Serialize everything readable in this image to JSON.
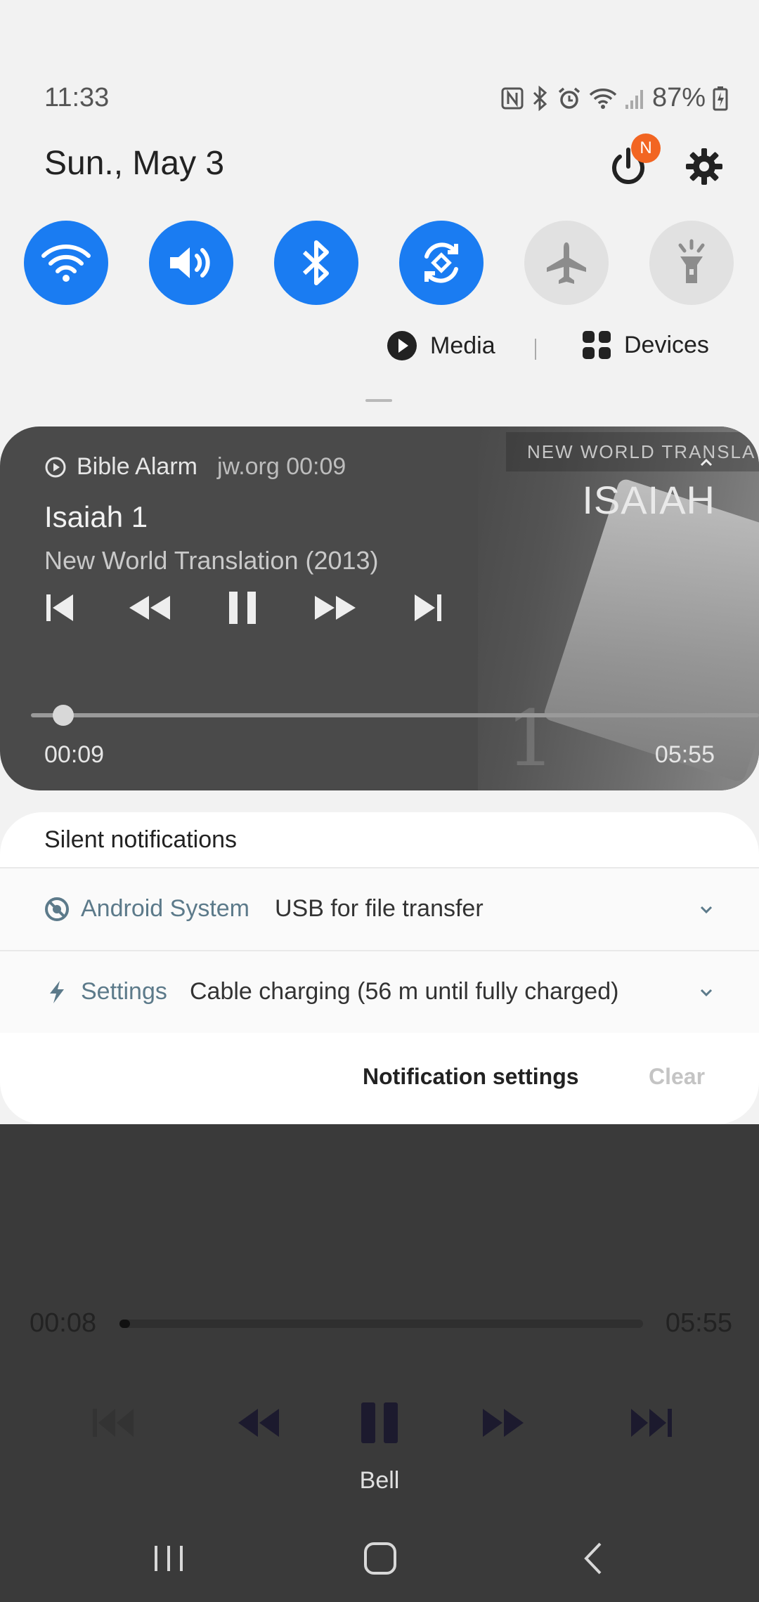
{
  "status_bar": {
    "time": "11:33",
    "battery": "87%",
    "icons": [
      "nfc-icon",
      "bluetooth-icon",
      "alarm-icon",
      "wifi-icon",
      "signal-icon",
      "battery-charging-icon"
    ]
  },
  "header": {
    "date": "Sun., May 3",
    "power_badge": "N"
  },
  "quick_toggles": [
    {
      "name": "wifi",
      "icon": "wifi-icon",
      "state": "on"
    },
    {
      "name": "sound",
      "icon": "volume-icon",
      "state": "on"
    },
    {
      "name": "bluetooth",
      "icon": "bluetooth-icon",
      "state": "on"
    },
    {
      "name": "auto-rotate",
      "icon": "rotate-icon",
      "state": "on"
    },
    {
      "name": "airplane-mode",
      "icon": "airplane-icon",
      "state": "off"
    },
    {
      "name": "flashlight",
      "icon": "flashlight-icon",
      "state": "off"
    }
  ],
  "media_row": {
    "media_label": "Media",
    "devices_label": "Devices"
  },
  "media_card": {
    "app_name": "Bible Alarm",
    "source": "jw.org 00:09",
    "title": "Isaiah 1",
    "subtitle": "New World Translation (2013)",
    "artwork_header": "NEW WORLD TRANSLAT",
    "artwork_title": "ISAIAH",
    "artwork_number": "1",
    "elapsed": "00:09",
    "total": "05:55",
    "progress": 0.025
  },
  "silent_notifications": {
    "header": "Silent notifications",
    "items": [
      {
        "app": "Android System",
        "message": "USB for file transfer"
      },
      {
        "app": "Settings",
        "message": "Cable charging (56 m until fully charged)"
      }
    ],
    "settings_label": "Notification settings",
    "clear_label": "Clear"
  },
  "background_app": {
    "elapsed": "00:08",
    "total": "05:55",
    "label": "Bell",
    "progress": 0.02
  },
  "colors": {
    "accent": "#1a7cf2",
    "badge": "#f26522",
    "card_bg": "#4a4a4a"
  }
}
